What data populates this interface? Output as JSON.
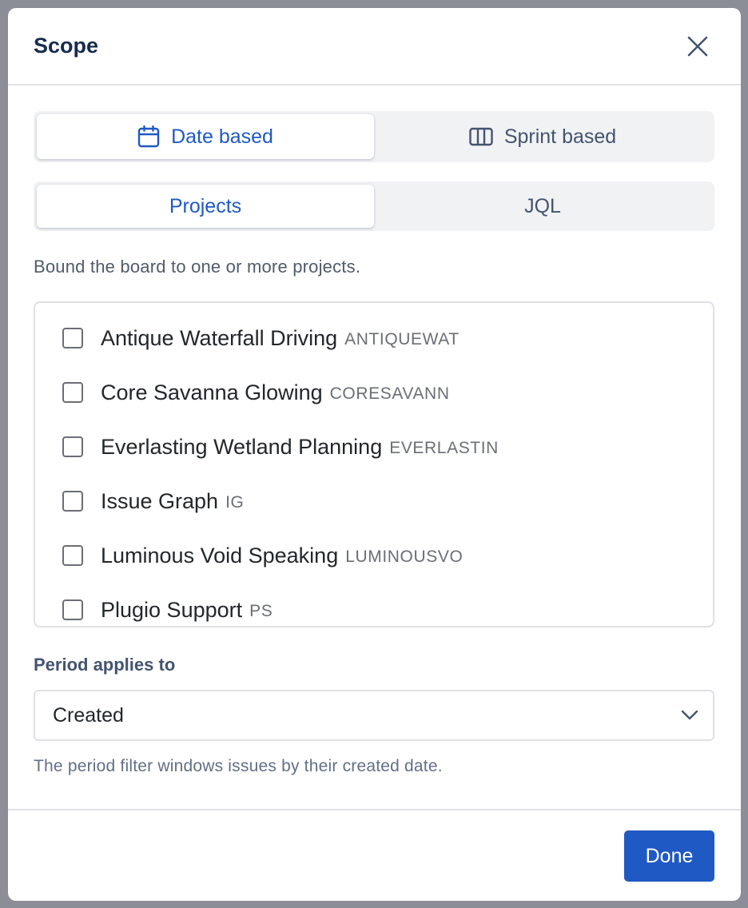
{
  "dialog": {
    "title": "Scope"
  },
  "mode_toggle": {
    "date_label": "Date based",
    "sprint_label": "Sprint based",
    "selected": "Date based"
  },
  "source_toggle": {
    "projects_label": "Projects",
    "jql_label": "JQL",
    "selected": "Projects"
  },
  "projects": {
    "help_text": "Bound the board to one or more projects.",
    "items": [
      {
        "name": "Antique Waterfall Driving",
        "key": "ANTIQUEWAT"
      },
      {
        "name": "Core Savanna Glowing",
        "key": "CORESAVANN"
      },
      {
        "name": "Everlasting Wetland Planning",
        "key": "EVERLASTIN"
      },
      {
        "name": "Issue Graph",
        "key": "IG"
      },
      {
        "name": "Luminous Void Speaking",
        "key": "LUMINOUSVO"
      },
      {
        "name": "Plugio Support",
        "key": "PS"
      }
    ]
  },
  "period": {
    "label": "Period applies to",
    "value": "Created",
    "hint": "The period filter windows issues by their created date."
  },
  "footer": {
    "done_label": "Done"
  },
  "colors": {
    "primary": "#1f59c4",
    "overlay": "#8b8e96"
  },
  "icons": {
    "close": "close-icon",
    "calendar": "calendar-icon",
    "sprint": "board-columns-icon",
    "dropdown": "chevron-down-icon"
  }
}
